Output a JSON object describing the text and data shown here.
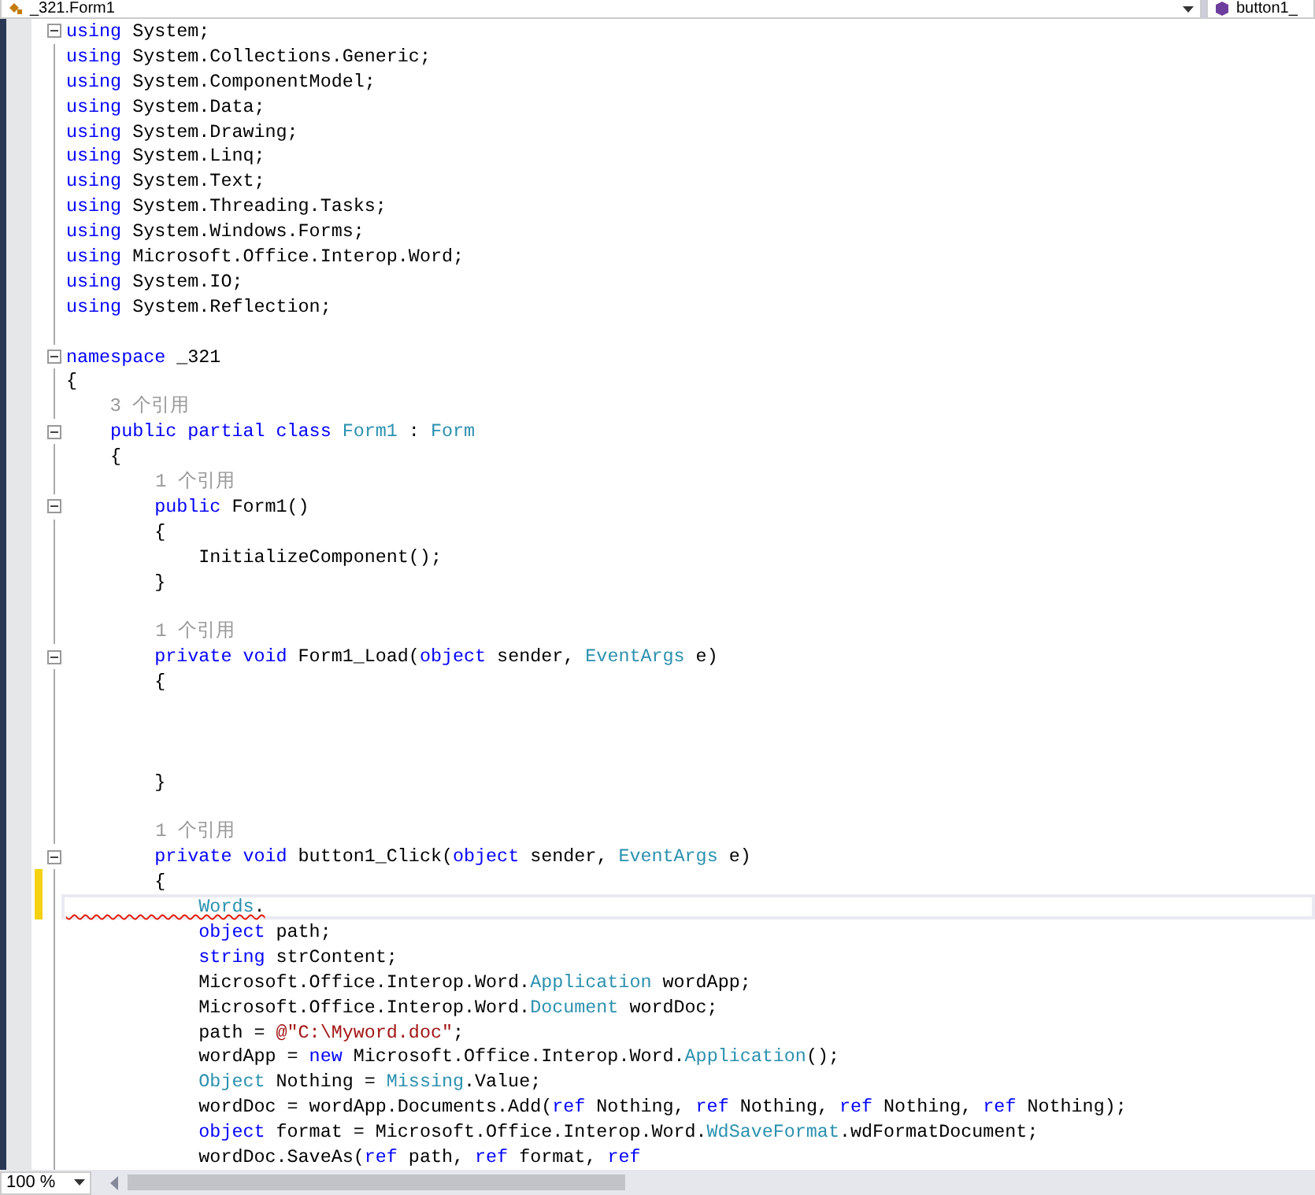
{
  "navigation_bar": {
    "type_dropdown": "_321.Form1",
    "member_dropdown": "button1_"
  },
  "editor": {
    "lines": [
      {
        "kind": "code",
        "fold": true,
        "changed": false,
        "current": false,
        "segs": [
          {
            "text": "using",
            "kind": "kw"
          },
          {
            "text": " System;",
            "kind": "txt"
          }
        ]
      },
      {
        "kind": "code",
        "fold": false,
        "changed": false,
        "current": false,
        "segs": [
          {
            "text": "using",
            "kind": "kw"
          },
          {
            "text": " System.Collections.Generic;",
            "kind": "txt"
          }
        ]
      },
      {
        "kind": "code",
        "fold": false,
        "changed": false,
        "current": false,
        "segs": [
          {
            "text": "using",
            "kind": "kw"
          },
          {
            "text": " System.ComponentModel;",
            "kind": "txt"
          }
        ]
      },
      {
        "kind": "code",
        "fold": false,
        "changed": false,
        "current": false,
        "segs": [
          {
            "text": "using",
            "kind": "kw"
          },
          {
            "text": " System.Data;",
            "kind": "txt"
          }
        ]
      },
      {
        "kind": "code",
        "fold": false,
        "changed": false,
        "current": false,
        "segs": [
          {
            "text": "using",
            "kind": "kw"
          },
          {
            "text": " System.Drawing;",
            "kind": "txt"
          }
        ]
      },
      {
        "kind": "code",
        "fold": false,
        "changed": false,
        "current": false,
        "segs": [
          {
            "text": "using",
            "kind": "kw"
          },
          {
            "text": " System.Linq;",
            "kind": "txt"
          }
        ]
      },
      {
        "kind": "code",
        "fold": false,
        "changed": false,
        "current": false,
        "segs": [
          {
            "text": "using",
            "kind": "kw"
          },
          {
            "text": " System.Text;",
            "kind": "txt"
          }
        ]
      },
      {
        "kind": "code",
        "fold": false,
        "changed": false,
        "current": false,
        "segs": [
          {
            "text": "using",
            "kind": "kw"
          },
          {
            "text": " System.Threading.Tasks;",
            "kind": "txt"
          }
        ]
      },
      {
        "kind": "code",
        "fold": false,
        "changed": false,
        "current": false,
        "segs": [
          {
            "text": "using",
            "kind": "kw"
          },
          {
            "text": " System.Windows.Forms;",
            "kind": "txt"
          }
        ]
      },
      {
        "kind": "code",
        "fold": false,
        "changed": false,
        "current": false,
        "segs": [
          {
            "text": "using",
            "kind": "kw"
          },
          {
            "text": " Microsoft.Office.Interop.Word;",
            "kind": "txt"
          }
        ]
      },
      {
        "kind": "code",
        "fold": false,
        "changed": false,
        "current": false,
        "segs": [
          {
            "text": "using",
            "kind": "kw"
          },
          {
            "text": " System.IO;",
            "kind": "txt"
          }
        ]
      },
      {
        "kind": "code",
        "fold": false,
        "changed": false,
        "current": false,
        "segs": [
          {
            "text": "using",
            "kind": "kw"
          },
          {
            "text": " System.Reflection;",
            "kind": "txt"
          }
        ]
      },
      {
        "kind": "blank",
        "fold": false,
        "changed": false,
        "current": false
      },
      {
        "kind": "code",
        "fold": true,
        "changed": false,
        "current": false,
        "segs": [
          {
            "text": "namespace",
            "kind": "kw"
          },
          {
            "text": " _321",
            "kind": "txt"
          }
        ]
      },
      {
        "kind": "code",
        "fold": false,
        "changed": false,
        "current": false,
        "segs": [
          {
            "text": "{",
            "kind": "txt"
          }
        ]
      },
      {
        "kind": "codelens",
        "fold": false,
        "changed": false,
        "current": false,
        "segs": [
          {
            "text": "    3 个引用",
            "kind": "ref"
          }
        ]
      },
      {
        "kind": "code",
        "fold": true,
        "changed": false,
        "current": false,
        "segs": [
          {
            "text": "    public partial class",
            "kind": "kw"
          },
          {
            "text": " Form1",
            "kind": "type"
          },
          {
            "text": " :",
            "kind": "txt"
          },
          {
            "text": " Form",
            "kind": "type"
          }
        ]
      },
      {
        "kind": "code",
        "fold": false,
        "changed": false,
        "current": false,
        "segs": [
          {
            "text": "    {",
            "kind": "txt"
          }
        ]
      },
      {
        "kind": "codelens",
        "fold": false,
        "changed": false,
        "current": false,
        "segs": [
          {
            "text": "        1 个引用",
            "kind": "ref"
          }
        ]
      },
      {
        "kind": "code",
        "fold": true,
        "changed": false,
        "current": false,
        "segs": [
          {
            "text": "        public",
            "kind": "kw"
          },
          {
            "text": " Form1()",
            "kind": "txt"
          }
        ]
      },
      {
        "kind": "code",
        "fold": false,
        "changed": false,
        "current": false,
        "segs": [
          {
            "text": "        {",
            "kind": "txt"
          }
        ]
      },
      {
        "kind": "code",
        "fold": false,
        "changed": false,
        "current": false,
        "segs": [
          {
            "text": "            InitializeComponent();",
            "kind": "txt"
          }
        ]
      },
      {
        "kind": "code",
        "fold": false,
        "changed": false,
        "current": false,
        "segs": [
          {
            "text": "        }",
            "kind": "txt"
          }
        ]
      },
      {
        "kind": "blank",
        "fold": false,
        "changed": false,
        "current": false
      },
      {
        "kind": "codelens",
        "fold": false,
        "changed": false,
        "current": false,
        "segs": [
          {
            "text": "        1 个引用",
            "kind": "ref"
          }
        ]
      },
      {
        "kind": "code",
        "fold": true,
        "changed": false,
        "current": false,
        "segs": [
          {
            "text": "        private void",
            "kind": "kw"
          },
          {
            "text": " Form1_Load(",
            "kind": "txt"
          },
          {
            "text": "object",
            "kind": "kw"
          },
          {
            "text": " sender,",
            "kind": "txt"
          },
          {
            "text": " EventArgs",
            "kind": "type"
          },
          {
            "text": " e)",
            "kind": "txt"
          }
        ]
      },
      {
        "kind": "code",
        "fold": false,
        "changed": false,
        "current": false,
        "segs": [
          {
            "text": "        {",
            "kind": "txt"
          }
        ]
      },
      {
        "kind": "blank",
        "fold": false,
        "changed": false,
        "current": false
      },
      {
        "kind": "blank",
        "fold": false,
        "changed": false,
        "current": false
      },
      {
        "kind": "blank",
        "fold": false,
        "changed": false,
        "current": false
      },
      {
        "kind": "code",
        "fold": false,
        "changed": false,
        "current": false,
        "segs": [
          {
            "text": "        }",
            "kind": "txt"
          }
        ]
      },
      {
        "kind": "blank",
        "fold": false,
        "changed": false,
        "current": false
      },
      {
        "kind": "codelens",
        "fold": false,
        "changed": false,
        "current": false,
        "segs": [
          {
            "text": "        1 个引用",
            "kind": "ref"
          }
        ]
      },
      {
        "kind": "code",
        "fold": true,
        "changed": false,
        "current": false,
        "segs": [
          {
            "text": "        private void",
            "kind": "kw"
          },
          {
            "text": " button1_Click(",
            "kind": "txt"
          },
          {
            "text": "object",
            "kind": "kw"
          },
          {
            "text": " sender,",
            "kind": "txt"
          },
          {
            "text": " EventArgs",
            "kind": "type"
          },
          {
            "text": " e)",
            "kind": "txt"
          }
        ]
      },
      {
        "kind": "code",
        "fold": false,
        "changed": true,
        "current": false,
        "segs": [
          {
            "text": "        {",
            "kind": "txt"
          }
        ]
      },
      {
        "kind": "code",
        "fold": false,
        "changed": true,
        "current": true,
        "segs": [
          {
            "text": "            Words",
            "kind": "type_error"
          },
          {
            "text": ".",
            "kind": "txt_error"
          }
        ]
      },
      {
        "kind": "code",
        "fold": false,
        "changed": false,
        "current": false,
        "segs": [
          {
            "text": "            object",
            "kind": "kw"
          },
          {
            "text": " path;",
            "kind": "txt"
          }
        ]
      },
      {
        "kind": "code",
        "fold": false,
        "changed": false,
        "current": false,
        "segs": [
          {
            "text": "            string",
            "kind": "kw"
          },
          {
            "text": " strContent;",
            "kind": "txt"
          }
        ]
      },
      {
        "kind": "code",
        "fold": false,
        "changed": false,
        "current": false,
        "segs": [
          {
            "text": "            Microsoft.Office.Interop.Word.",
            "kind": "txt"
          },
          {
            "text": "Application",
            "kind": "type"
          },
          {
            "text": " wordApp;",
            "kind": "txt"
          }
        ]
      },
      {
        "kind": "code",
        "fold": false,
        "changed": false,
        "current": false,
        "segs": [
          {
            "text": "            Microsoft.Office.Interop.Word.",
            "kind": "txt"
          },
          {
            "text": "Document",
            "kind": "type"
          },
          {
            "text": " wordDoc;",
            "kind": "txt"
          }
        ]
      },
      {
        "kind": "code",
        "fold": false,
        "changed": false,
        "current": false,
        "segs": [
          {
            "text": "            path =",
            "kind": "txt"
          },
          {
            "text": " @\"C:\\Myword.doc\"",
            "kind": "str"
          },
          {
            "text": ";",
            "kind": "txt"
          }
        ]
      },
      {
        "kind": "code",
        "fold": false,
        "changed": false,
        "current": false,
        "segs": [
          {
            "text": "            wordApp =",
            "kind": "txt"
          },
          {
            "text": " new",
            "kind": "kw"
          },
          {
            "text": " Microsoft.Office.Interop.Word.",
            "kind": "txt"
          },
          {
            "text": "Application",
            "kind": "type"
          },
          {
            "text": "();",
            "kind": "txt"
          }
        ]
      },
      {
        "kind": "code",
        "fold": false,
        "changed": false,
        "current": false,
        "segs": [
          {
            "text": "            Object",
            "kind": "type"
          },
          {
            "text": " Nothing =",
            "kind": "txt"
          },
          {
            "text": " Missing",
            "kind": "type"
          },
          {
            "text": ".Value;",
            "kind": "txt"
          }
        ]
      },
      {
        "kind": "code",
        "fold": false,
        "changed": false,
        "current": false,
        "segs": [
          {
            "text": "            wordDoc = wordApp.Documents.Add(",
            "kind": "txt"
          },
          {
            "text": "ref",
            "kind": "kw"
          },
          {
            "text": " Nothing,",
            "kind": "txt"
          },
          {
            "text": " ref",
            "kind": "kw"
          },
          {
            "text": " Nothing,",
            "kind": "txt"
          },
          {
            "text": " ref",
            "kind": "kw"
          },
          {
            "text": " Nothing,",
            "kind": "txt"
          },
          {
            "text": " ref",
            "kind": "kw"
          },
          {
            "text": " Nothing);",
            "kind": "txt"
          }
        ]
      },
      {
        "kind": "code",
        "fold": false,
        "changed": false,
        "current": false,
        "segs": [
          {
            "text": "            object",
            "kind": "kw"
          },
          {
            "text": " format = Microsoft.Office.Interop.Word.",
            "kind": "txt"
          },
          {
            "text": "WdSaveFormat",
            "kind": "type"
          },
          {
            "text": ".wdFormatDocument;",
            "kind": "txt"
          }
        ]
      },
      {
        "kind": "code",
        "fold": false,
        "changed": false,
        "current": false,
        "segs": [
          {
            "text": "            wordDoc.SaveAs(",
            "kind": "txt"
          },
          {
            "text": "ref",
            "kind": "kw"
          },
          {
            "text": " path,",
            "kind": "txt"
          },
          {
            "text": " ref",
            "kind": "kw"
          },
          {
            "text": " format,",
            "kind": "txt"
          },
          {
            "text": " ref",
            "kind": "kw"
          }
        ]
      }
    ]
  },
  "status": {
    "zoom": "100 %"
  }
}
